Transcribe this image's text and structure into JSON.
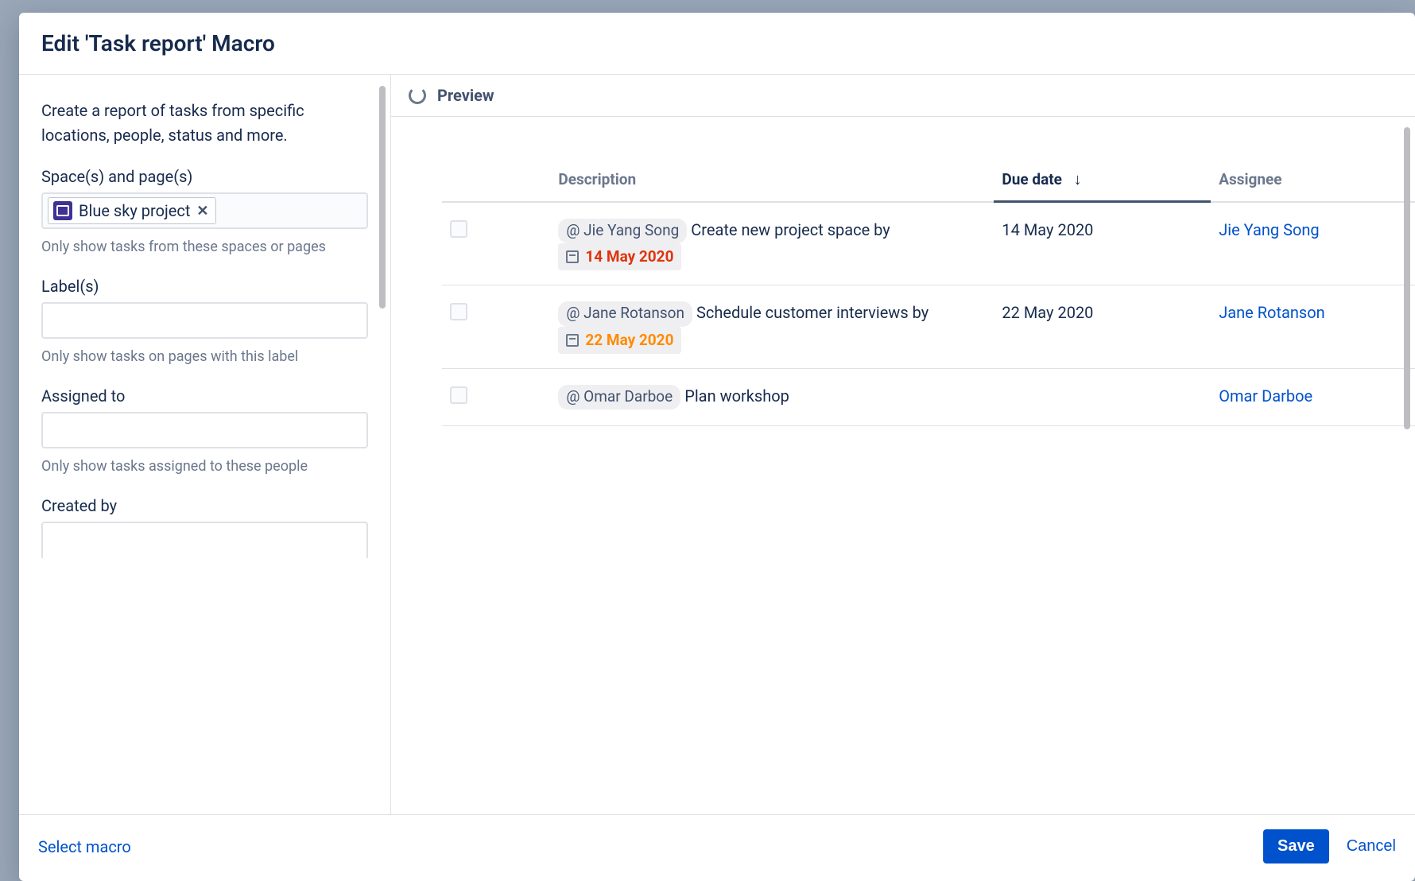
{
  "header": {
    "title": "Edit 'Task report' Macro"
  },
  "form": {
    "intro": "Create a report of tasks from specific locations, people, status and more.",
    "spaces": {
      "label": "Space(s) and page(s)",
      "token": "Blue sky project",
      "help": "Only show tasks from these spaces or pages"
    },
    "labels": {
      "label": "Label(s)",
      "help": "Only show tasks on pages with this label"
    },
    "assigned": {
      "label": "Assigned to",
      "help": "Only show tasks assigned to these people"
    },
    "created": {
      "label": "Created by"
    }
  },
  "preview": {
    "title": "Preview",
    "columns": {
      "description": "Description",
      "due": "Due date",
      "assignee": "Assignee"
    }
  },
  "tasks": [
    {
      "mention": "@ Jie Yang Song",
      "text_before": "Create new project space  by",
      "badge_date": "14 May 2020",
      "badge_class": "red",
      "due": "14 May 2020",
      "assignee": "Jie Yang Song"
    },
    {
      "mention": "@ Jane Rotanson",
      "text_before": "Schedule customer interviews by",
      "badge_date": "22 May 2020",
      "badge_class": "orange",
      "due": "22 May 2020",
      "assignee": "Jane Rotanson"
    },
    {
      "mention": "@ Omar Darboe",
      "text_before": "Plan workshop",
      "badge_date": "",
      "badge_class": "",
      "due": "",
      "assignee": "Omar Darboe"
    }
  ],
  "footer": {
    "select_macro": "Select macro",
    "save": "Save",
    "cancel": "Cancel"
  }
}
